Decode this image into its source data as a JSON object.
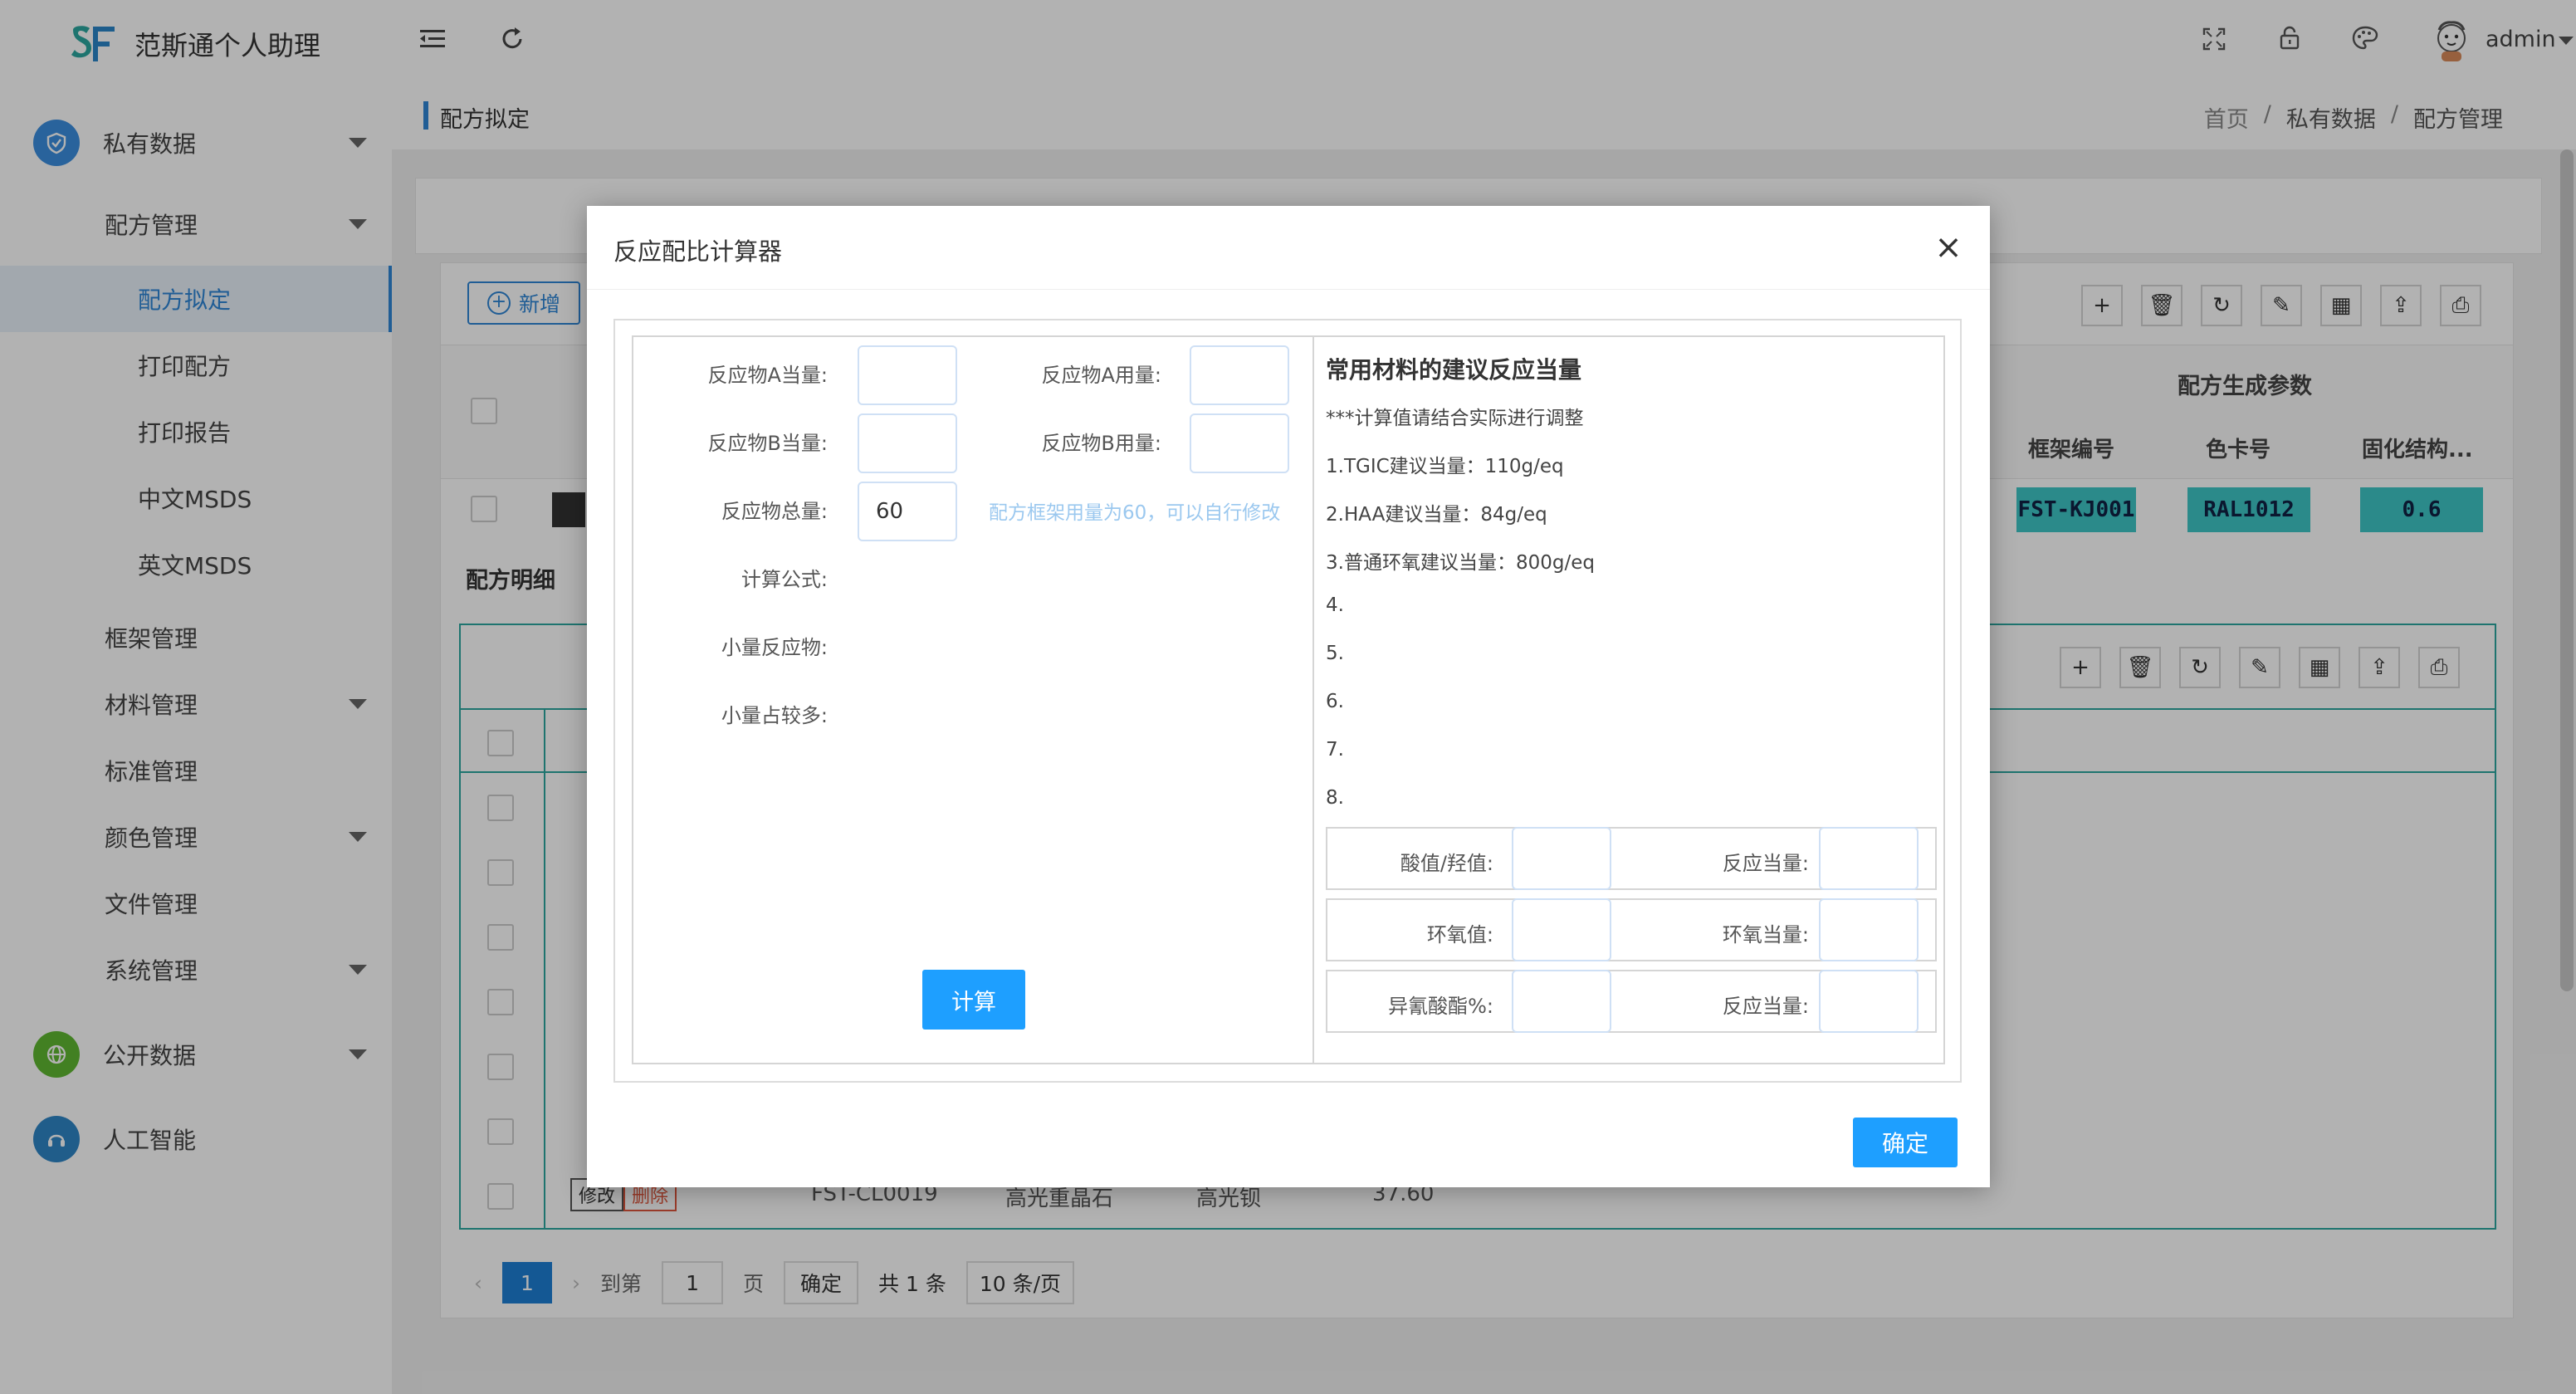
{
  "app": {
    "title": "范斯通个人助理",
    "user": "admin"
  },
  "sidebar": {
    "groups": [
      {
        "label": "私有数据",
        "icon": "shield-icon"
      },
      {
        "label": "公开数据",
        "icon": "globe-icon"
      },
      {
        "label": "人工智能",
        "icon": "headset-icon"
      }
    ],
    "items": [
      {
        "label": "配方管理"
      },
      {
        "label": "配方拟定"
      },
      {
        "label": "打印配方"
      },
      {
        "label": "打印报告"
      },
      {
        "label": "中文MSDS"
      },
      {
        "label": "英文MSDS"
      },
      {
        "label": "框架管理"
      },
      {
        "label": "材料管理"
      },
      {
        "label": "标准管理"
      },
      {
        "label": "颜色管理"
      },
      {
        "label": "文件管理"
      },
      {
        "label": "系统管理"
      }
    ]
  },
  "page": {
    "title": "配方拟定",
    "breadcrumb": [
      "首页",
      "私有数据",
      "配方管理"
    ],
    "separator": "/"
  },
  "background": {
    "add_label": "新增",
    "params_header": "配方生成参数",
    "columns": [
      "框架编号",
      "色卡号",
      "固化结构..."
    ],
    "row": {
      "frame_no": "FST-KJ001",
      "color_no": "RAL1012",
      "cure": "0.6"
    },
    "detail_title": "配方明细",
    "detail_row": {
      "edit": "修改",
      "delete": "删除",
      "code": "FST-CL0019",
      "name": "高光重晶石",
      "alias": "高光钡",
      "value": "37.60"
    },
    "pager": {
      "current": "1",
      "goto": "到第",
      "page_input": "1",
      "page": "页",
      "confirm": "确定",
      "total": "共 1 条",
      "size": "10 条/页"
    }
  },
  "modal": {
    "title": "反应配比计算器",
    "close": "×",
    "left": {
      "a_eq_label": "反应物A当量:",
      "a_amt_label": "反应物A用量:",
      "b_eq_label": "反应物B当量:",
      "b_amt_label": "反应物B用量:",
      "total_label": "反应物总量:",
      "total_value": "60",
      "hint": "配方框架用量为60，可以自行修改",
      "formula_label": "计算公式:",
      "minor_label": "小量反应物:",
      "excess_label": "小量占较多:",
      "calc_button": "计算"
    },
    "right": {
      "title": "常用材料的建议反应当量",
      "note": "***计算值请结合实际进行调整",
      "lines": [
        "1.TGIC建议当量：110g/eq",
        "2.HAA建议当量：84g/eq",
        "3.普通环氧建议当量：800g/eq",
        "4.",
        "5.",
        "6.",
        "7.",
        "8."
      ],
      "rows": [
        {
          "left": "酸值/羟值:",
          "right": "反应当量:"
        },
        {
          "left": "环氧值:",
          "right": "环氧当量:"
        },
        {
          "left": "异氰酸酯%:",
          "right": "反应当量:"
        }
      ]
    },
    "ok_button": "确定"
  }
}
